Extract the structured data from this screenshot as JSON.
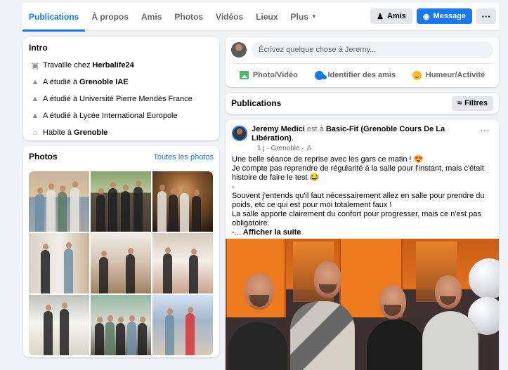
{
  "profile_nav": {
    "tabs": [
      "Publications",
      "À propos",
      "Amis",
      "Photos",
      "Vidéos",
      "Lieux",
      "Plus"
    ],
    "active_tab": "Publications",
    "friends_button": "Amis",
    "message_button": "Message",
    "more_button": "···"
  },
  "intro": {
    "title": "Intro",
    "items": [
      {
        "icon": "work-icon",
        "text_before": "Travaille chez",
        "strong": "Herbalife24"
      },
      {
        "icon": "education-icon",
        "text_before": "A étudié à",
        "strong": "Grenoble IAE"
      },
      {
        "icon": "education-icon",
        "text_before": "A étudié à Université Pierre Mendès France",
        "strong": ""
      },
      {
        "icon": "education-icon",
        "text_before": "A étudié à Lycée International Europole",
        "strong": ""
      },
      {
        "icon": "home-icon",
        "text_before": "Habite à",
        "strong": "Grenoble"
      }
    ]
  },
  "photos": {
    "title": "Photos",
    "link": "Toutes les photos",
    "count": 9
  },
  "composer": {
    "placeholder": "Écrivez quelque chose à Jeremy...",
    "actions": [
      "Photo/Vidéo",
      "Identifier des amis",
      "Humeur/Activité"
    ]
  },
  "publications": {
    "title": "Publications",
    "filter_button": "Filtres"
  },
  "post": {
    "author": "Jeremy Medici",
    "location_prefix": "est à",
    "location": "Basic-Fit (Grenoble Cours De La Libération)",
    "period": ".",
    "meta": "1 j · Grenoble · ",
    "more": "···",
    "lines": [
      "Une belle séance de reprise avec les gars ce matin ! 😍",
      "Je compte pas reprendre de régularité à la salle pour l'instant, mais c'était histoire de faire le test 😂",
      "-",
      "Souvent j'entends qu'il faut nécessairement allez en salle pour prendre du poids, etc ce qui est pour moi totalement faux !",
      "La salle apporte clairement du confort pour progresser, mais ce n'est pas obligatoire."
    ],
    "see_more_prefix": "-... ",
    "see_more": "Afficher la suite"
  },
  "colors": {
    "facebook_blue": "#1877f2",
    "page_bg": "#f0f2f5",
    "gym_orange": "#e1701f"
  }
}
